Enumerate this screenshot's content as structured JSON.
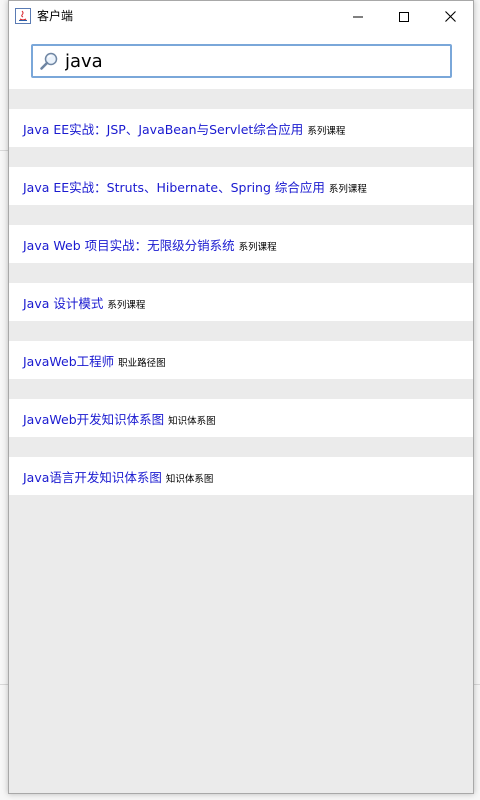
{
  "window": {
    "title": "客户端"
  },
  "search": {
    "value": "java"
  },
  "results": [
    {
      "title": "Java EE实战：JSP、JavaBean与Servlet综合应用",
      "tag": "系列课程"
    },
    {
      "title": "Java EE实战：Struts、Hibernate、Spring 综合应用",
      "tag": "系列课程"
    },
    {
      "title": "Java Web 项目实战：无限级分销系统",
      "tag": "系列课程"
    },
    {
      "title": "Java 设计模式",
      "tag": "系列课程"
    },
    {
      "title": "JavaWeb工程师",
      "tag": "职业路径图"
    },
    {
      "title": "JavaWeb开发知识体系图",
      "tag": "知识体系图"
    },
    {
      "title": "Java语言开发知识体系图",
      "tag": "知识体系图"
    }
  ],
  "colors": {
    "link": "#1a1ad0",
    "focus_border": "#7aa7d9",
    "panel": "#ebebeb"
  },
  "icons": [
    "java-app-icon",
    "minimize-icon",
    "maximize-icon",
    "close-icon",
    "magnifier-icon"
  ]
}
